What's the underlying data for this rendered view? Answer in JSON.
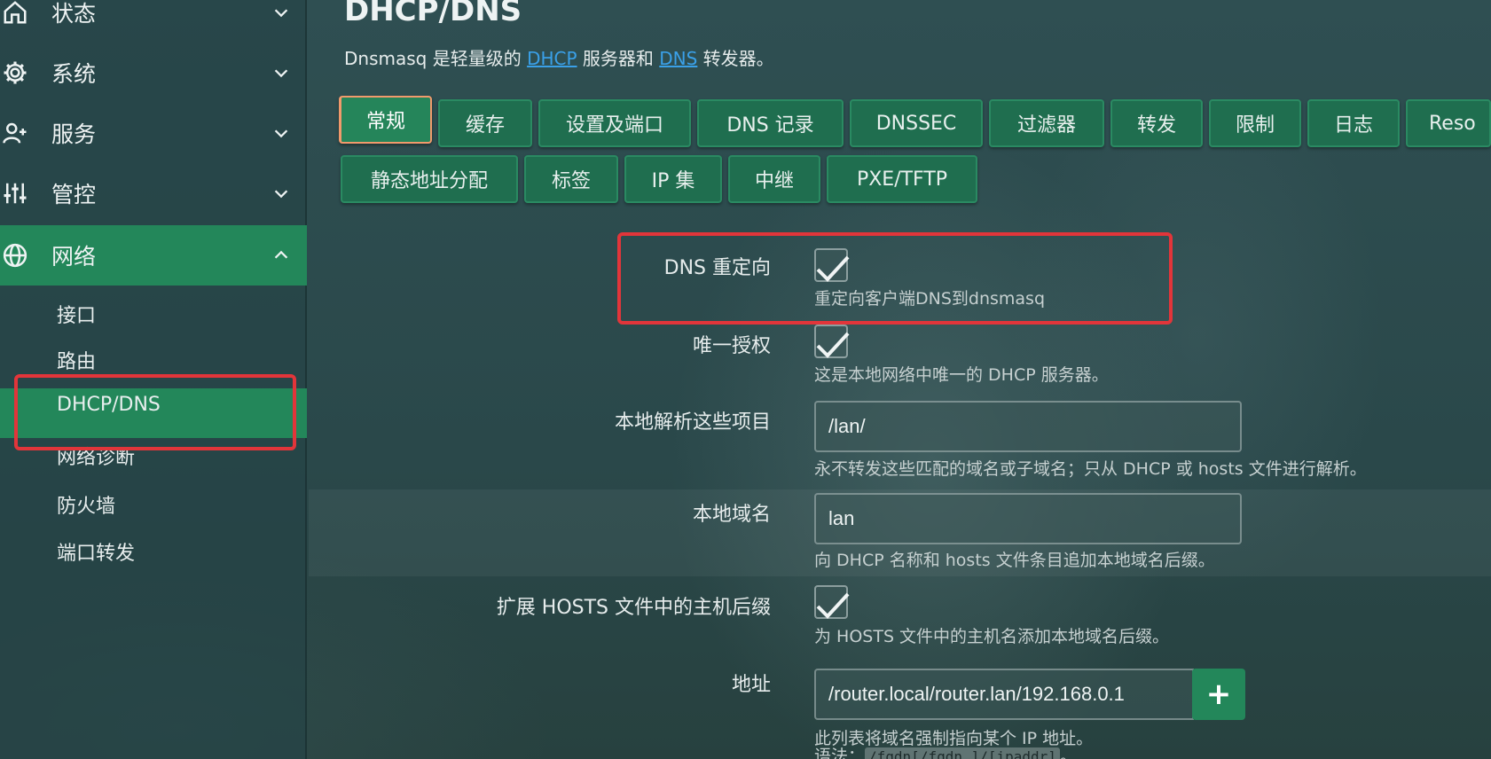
{
  "sidebar": {
    "items": [
      {
        "label": "状态",
        "icon": "home-icon",
        "expanded": false
      },
      {
        "label": "系统",
        "icon": "gear-icon",
        "expanded": false
      },
      {
        "label": "服务",
        "icon": "user-plus-icon",
        "expanded": false
      },
      {
        "label": "管控",
        "icon": "sliders-icon",
        "expanded": false
      },
      {
        "label": "网络",
        "icon": "globe-icon",
        "expanded": true
      }
    ],
    "subitems": [
      {
        "label": "接口"
      },
      {
        "label": "路由"
      },
      {
        "label": "DHCP/DNS"
      },
      {
        "label": "网络诊断"
      },
      {
        "label": "防火墙"
      },
      {
        "label": "端口转发"
      }
    ],
    "active_subitem": "DHCP/DNS"
  },
  "page": {
    "title": "DHCP/DNS",
    "desc_prefix": "Dnsmasq 是轻量级的 ",
    "desc_link1": "DHCP",
    "desc_mid": " 服务器和 ",
    "desc_link2": "DNS",
    "desc_suffix": " 转发器。"
  },
  "tabs": {
    "row1": [
      "常规",
      "缓存",
      "设置及端口",
      "DNS 记录",
      "DNSSEC",
      "过滤器",
      "转发",
      "限制",
      "日志",
      "Reso"
    ],
    "row2": [
      "静态地址分配",
      "标签",
      "IP 集",
      "中继",
      "PXE/TFTP"
    ],
    "active": "常规"
  },
  "form": {
    "dns_redirect": {
      "label": "DNS 重定向",
      "checked": true,
      "hint": "重定向客户端DNS到dnsmasq"
    },
    "authoritative": {
      "label": "唯一授权",
      "checked": true,
      "hint": "这是本地网络中唯一的 DHCP 服务器。"
    },
    "local_resolve": {
      "label": "本地解析这些项目",
      "value": "/lan/",
      "hint": "永不转发这些匹配的域名或子域名；只从 DHCP 或 hosts 文件进行解析。"
    },
    "local_domain": {
      "label": "本地域名",
      "value": "lan",
      "hint": "向 DHCP 名称和 hosts 文件条目追加本地域名后缀。"
    },
    "expand_hosts": {
      "label": "扩展 HOSTS 文件中的主机后缀",
      "checked": true,
      "hint": "为 HOSTS 文件中的主机名添加本地域名后缀。"
    },
    "address": {
      "label": "地址",
      "value": "/router.local/router.lan/192.168.0.1",
      "add_label": "+",
      "hint": "此列表将域名强制指向某个 IP 地址。",
      "syntax_prefix": "语法：",
      "syntax_code": "/fqdn[/fqdn…]/[ipaddr]",
      "syntax_suffix": "。"
    }
  },
  "colors": {
    "accent": "#23875a",
    "highlight": "#e2353a",
    "link": "#3aa0e8",
    "active_tab_border": "#f19a6c"
  }
}
